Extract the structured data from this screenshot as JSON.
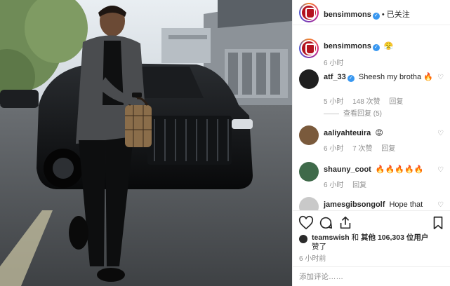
{
  "post": {
    "author": "bensimmons",
    "follow_status": "• 已关注",
    "caption_emoji": "😤",
    "caption_time": "6 小时",
    "like_summary_user": "teamswish",
    "like_summary_mid": " 和 ",
    "like_summary_count": "其他 106,303 位用户",
    "like_summary_tail": "赞了",
    "post_time": "6 小时前",
    "comment_placeholder": "添加评论……"
  },
  "comments": [
    {
      "user": "atf_33",
      "verified": true,
      "text": "Sheesh my brotha 🔥",
      "time": "5 小时",
      "likes": "148 次赞",
      "reply": "回复",
      "view_replies": "查看回复 (5)"
    },
    {
      "user": "aaliyahteuira",
      "verified": false,
      "text": "😡",
      "time": "6 小时",
      "likes": "7 次赞",
      "reply": "回复"
    },
    {
      "user": "shauny_coot",
      "verified": false,
      "text": "🔥🔥🔥🔥🔥",
      "time": "6 小时",
      "likes": "",
      "reply": "回复"
    },
    {
      "user": "jamesgibsongolf",
      "verified": false,
      "text": "Hope that",
      "time": "",
      "likes": "",
      "reply": ""
    }
  ],
  "icons": {
    "like": "heart-outline-icon",
    "comment": "comment-bubble-icon",
    "share": "share-arrow-icon",
    "save": "bookmark-icon",
    "verified": "verified-badge-icon"
  },
  "colors": {
    "verified": "#3897f0",
    "muted_text": "#8e8e8e",
    "text": "#262626",
    "avatar_red": "#b3121f"
  }
}
